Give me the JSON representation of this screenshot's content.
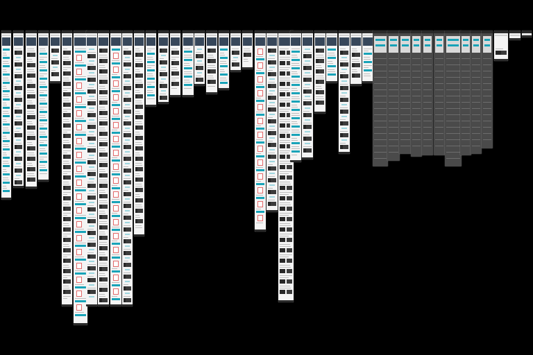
{
  "board": {
    "background": "#000000",
    "theme_light": "#f4f4f4",
    "theme_dark": "#4a4a4a",
    "accent": "#18a3b8"
  }
}
